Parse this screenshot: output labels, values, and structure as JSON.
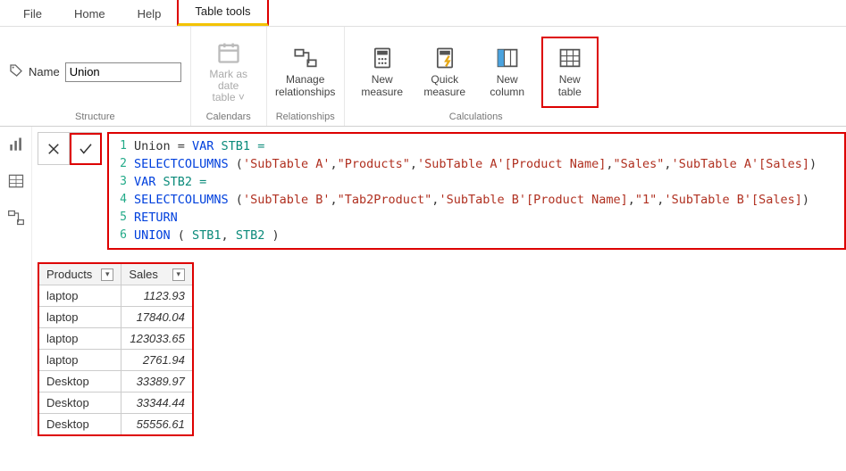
{
  "tabs": {
    "file": "File",
    "home": "Home",
    "help": "Help",
    "tabletools": "Table tools"
  },
  "ribbon": {
    "name_label": "Name",
    "name_value": "Union",
    "groups": {
      "structure": "Structure",
      "calendars": "Calendars",
      "relationships": "Relationships",
      "calculations": "Calculations"
    },
    "mark_as_date": "Mark as date\ntable ˅",
    "manage_rel": "Manage\nrelationships",
    "new_measure": "New\nmeasure",
    "quick_measure": "Quick\nmeasure",
    "new_column": "New\ncolumn",
    "new_table": "New\ntable"
  },
  "dax": {
    "l1_a": "Union = ",
    "l1_b": "VAR",
    "l1_c": " STB1 =",
    "l2_a": "SELECTCOLUMNS",
    "l2_b": " (",
    "l2_c": "'SubTable A'",
    "l2_d": ",",
    "l2_e": "\"Products\"",
    "l2_f": ",",
    "l2_g": "'SubTable A'[Product Name]",
    "l2_h": ",",
    "l2_i": "\"Sales\"",
    "l2_j": ",",
    "l2_k": "'SubTable A'[Sales]",
    "l2_l": ")",
    "l3_a": "VAR",
    "l3_b": " STB2 =",
    "l4_a": "SELECTCOLUMNS",
    "l4_b": " (",
    "l4_c": "'SubTable B'",
    "l4_d": ",",
    "l4_e": "\"Tab2Product\"",
    "l4_f": ",",
    "l4_g": "'SubTable B'[Product Name]",
    "l4_h": ",",
    "l4_i": "\"1\"",
    "l4_j": ",",
    "l4_k": "'SubTable B'[Sales]",
    "l4_l": ")",
    "l5_a": "RETURN",
    "l6_a": "UNION",
    "l6_b": " ( ",
    "l6_c": "STB1",
    "l6_d": ", ",
    "l6_e": "STB2",
    "l6_f": " )"
  },
  "table": {
    "columns": {
      "c0": "Products",
      "c1": "Sales"
    },
    "rows": [
      {
        "p": "laptop",
        "s": "1123.93"
      },
      {
        "p": "laptop",
        "s": "17840.04"
      },
      {
        "p": "laptop",
        "s": "123033.65"
      },
      {
        "p": "laptop",
        "s": "2761.94"
      },
      {
        "p": "Desktop",
        "s": "33389.97"
      },
      {
        "p": "Desktop",
        "s": "33344.44"
      },
      {
        "p": "Desktop",
        "s": "55556.61"
      }
    ]
  },
  "gutter": [
    "1",
    "2",
    "3",
    "4",
    "5",
    "6"
  ]
}
